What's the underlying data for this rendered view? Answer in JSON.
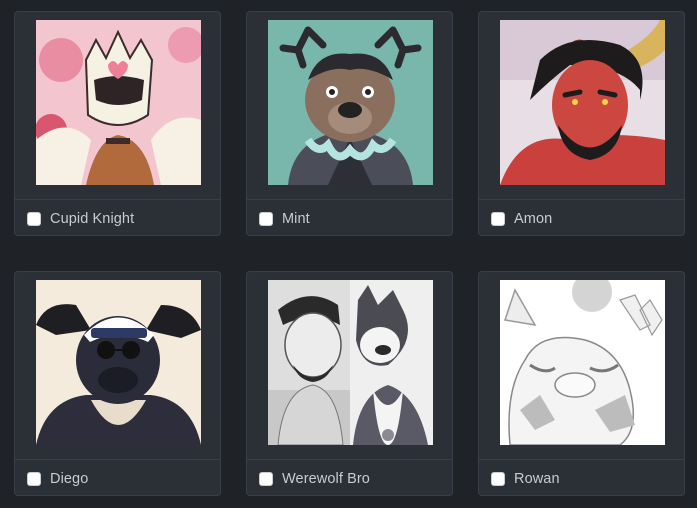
{
  "cards": [
    {
      "name": "Cupid Knight",
      "checked": false
    },
    {
      "name": "Mint",
      "checked": false
    },
    {
      "name": "Amon",
      "checked": false
    },
    {
      "name": "Diego",
      "checked": false
    },
    {
      "name": "Werewolf Bro",
      "checked": false
    },
    {
      "name": "Rowan",
      "checked": false
    }
  ],
  "colors": {
    "page_bg": "#1f2227",
    "card_bg": "#2b2f36",
    "card_border": "#3a3f47",
    "label_text": "#c8ccd2",
    "checkbox_bg": "#ffffff"
  }
}
